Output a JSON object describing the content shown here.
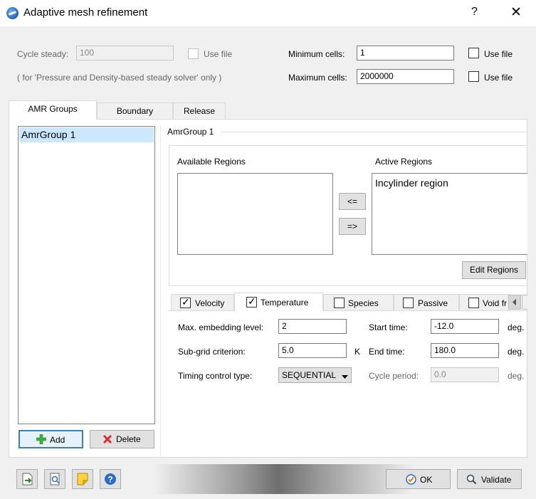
{
  "window": {
    "title": "Adaptive mesh refinement",
    "help_label": "?",
    "close_label": "✕"
  },
  "settings": {
    "cycle_steady_label": "Cycle steady:",
    "cycle_steady_value": "100",
    "use_file_label": "Use file",
    "note": "( for 'Pressure and Density-based steady solver' only )",
    "min_cells_label": "Minimum cells:",
    "min_cells_value": "1",
    "max_cells_label": "Maximum cells:",
    "max_cells_value": "2000000"
  },
  "tabs": [
    "AMR Groups",
    "Boundary",
    "Release"
  ],
  "groups": {
    "items": [
      "AmrGroup 1"
    ],
    "add_label": "Add",
    "delete_label": "Delete"
  },
  "group_detail": {
    "title": "AmrGroup 1",
    "available_regions_label": "Available Regions",
    "active_regions_label": "Active Regions",
    "active_regions": [
      "Incylinder region"
    ],
    "move_left_label": "<=",
    "move_right_label": "=>",
    "edit_regions_label": "Edit Regions"
  },
  "subtabs": [
    {
      "label": "Velocity",
      "checked": true
    },
    {
      "label": "Temperature",
      "checked": true
    },
    {
      "label": "Species",
      "checked": false
    },
    {
      "label": "Passive",
      "checked": false
    },
    {
      "label": "Void fr",
      "checked": false
    }
  ],
  "temperature": {
    "max_embed_label": "Max. embedding level:",
    "max_embed_value": "2",
    "subgrid_label": "Sub-grid criterion:",
    "subgrid_value": "5.0",
    "subgrid_unit": "K",
    "timing_label": "Timing control type:",
    "timing_value": "SEQUENTIAL",
    "start_time_label": "Start time:",
    "start_time_value": "-12.0",
    "end_time_label": "End time:",
    "end_time_value": "180.0",
    "cycle_period_label": "Cycle period:",
    "cycle_period_value": "0.0",
    "deg_unit": "deg."
  },
  "footer": {
    "ok_label": "OK",
    "validate_label": "Validate"
  },
  "colors": {
    "selection": "#cce8ff",
    "add_green": "#3fae3f",
    "delete_red": "#d92b2b",
    "help_blue": "#2a6cc4"
  }
}
